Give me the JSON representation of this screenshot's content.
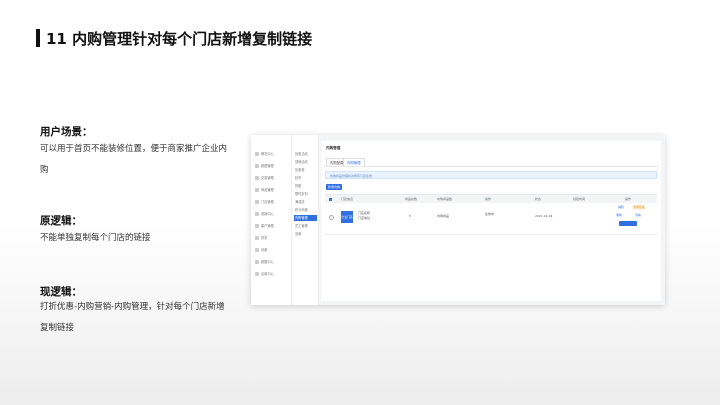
{
  "title": "11 内购管理针对每个门店新增复制链接",
  "sections": [
    {
      "heading": "用户场景：",
      "text": "可以用于首页不能装修位置，便于商家推广企业内购"
    },
    {
      "heading": "原逻辑：",
      "text": "不能单独复制每个门店的链接"
    },
    {
      "heading": "现逻辑：",
      "text": "打折优惠-内购营销-内购管理，针对每个门店新增复制链接"
    }
  ],
  "screenshot": {
    "nav_primary": [
      "概况中心",
      "数据管理",
      "交易管理",
      "商品管理",
      "门店管理",
      "营销中心",
      "客户管理",
      "财务",
      "设置",
      "数据中心",
      "应用中心"
    ],
    "nav_secondary": [
      "优惠活动",
      "营销活动",
      "优惠券",
      "秒杀",
      "拼团",
      "限时折扣",
      "满减送",
      "积分商城",
      "内购管理",
      "员工管理",
      "设置"
    ],
    "page_heading": "内购管理",
    "tabs": [
      "内购配置",
      "内购管理"
    ],
    "notice": "内购商品管理将对所有门店生效",
    "add_button": "新增内购",
    "table_headers": [
      "门店信息",
      "商品总数",
      "内购商品数",
      "操作",
      "状态",
      "创建时间",
      "操作"
    ],
    "row": {
      "thumb": "企业门店",
      "name": "门店名称",
      "address": "门店地址",
      "count": "5",
      "goods": "内购商品",
      "status": "生效中",
      "time": "2021-01-04",
      "actions": [
        "编辑",
        "复制链接",
        "删除",
        "查看"
      ]
    }
  }
}
